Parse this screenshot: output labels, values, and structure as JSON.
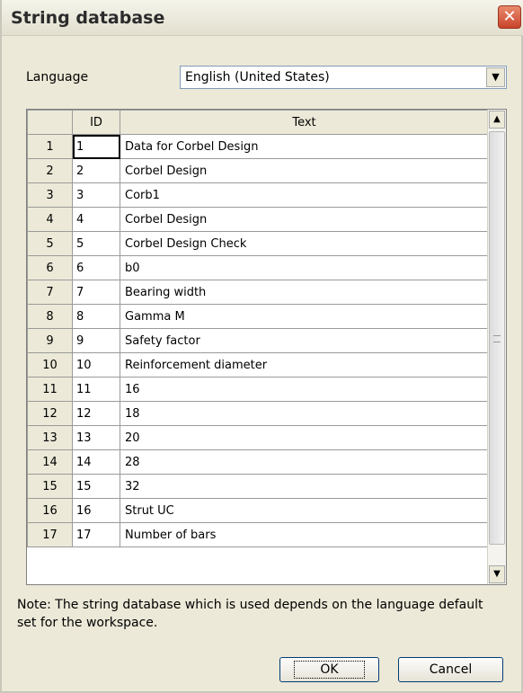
{
  "window": {
    "title": "String database",
    "close_symbol": "✕"
  },
  "language": {
    "label": "Language",
    "value": "English (United States)",
    "dropdown_symbol": "▼"
  },
  "grid": {
    "columns": [
      "ID",
      "Text"
    ],
    "rows": [
      {
        "num": "1",
        "id": "1",
        "text": "Data for Corbel Design"
      },
      {
        "num": "2",
        "id": "2",
        "text": "Corbel Design"
      },
      {
        "num": "3",
        "id": "3",
        "text": "Corb1"
      },
      {
        "num": "4",
        "id": "4",
        "text": "Corbel Design"
      },
      {
        "num": "5",
        "id": "5",
        "text": "Corbel Design Check"
      },
      {
        "num": "6",
        "id": "6",
        "text": "b0"
      },
      {
        "num": "7",
        "id": "7",
        "text": "Bearing width"
      },
      {
        "num": "8",
        "id": "8",
        "text": "Gamma M"
      },
      {
        "num": "9",
        "id": "9",
        "text": "Safety factor"
      },
      {
        "num": "10",
        "id": "10",
        "text": "Reinforcement diameter"
      },
      {
        "num": "11",
        "id": "11",
        "text": "16"
      },
      {
        "num": "12",
        "id": "12",
        "text": "18"
      },
      {
        "num": "13",
        "id": "13",
        "text": "20"
      },
      {
        "num": "14",
        "id": "14",
        "text": "28"
      },
      {
        "num": "15",
        "id": "15",
        "text": "32"
      },
      {
        "num": "16",
        "id": "16",
        "text": "Strut UC"
      },
      {
        "num": "17",
        "id": "17",
        "text": "Number of bars"
      }
    ],
    "scroll_up_symbol": "▲",
    "scroll_down_symbol": "▼"
  },
  "note": "Note: The string database which is used depends on the language default set for the workspace.",
  "buttons": {
    "ok": "OK",
    "cancel": "Cancel"
  }
}
